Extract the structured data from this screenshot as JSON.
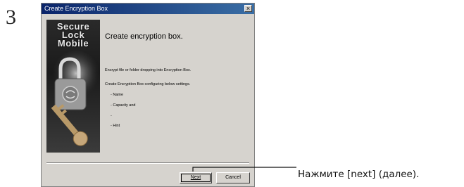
{
  "step_number": "3",
  "window": {
    "title": "Create Encryption Box",
    "close_glyph": "×",
    "logo_line1": "Secure",
    "logo_line2": "Lock",
    "logo_line3": "Mobile",
    "heading": "Create encryption box.",
    "desc1": "Encrypt file or folder dropping into Encryption Box.",
    "desc2": "Create Encryption Box configuring below settings.",
    "item_name": "- Name",
    "item_capacity": "- Capacity and",
    "item_blank": "-",
    "item_hint": "- Hint",
    "next_label": "Next",
    "cancel_label": "Cancel"
  },
  "annotation": "Нажмите [next] (далее)."
}
